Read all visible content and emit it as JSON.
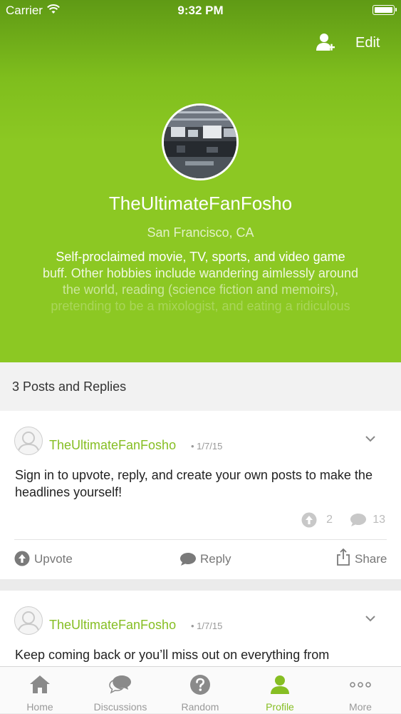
{
  "status_bar": {
    "carrier": "Carrier",
    "time": "9:32 PM"
  },
  "header": {
    "edit_label": "Edit"
  },
  "profile": {
    "username": "TheUltimateFanFosho",
    "location": "San Francisco, CA",
    "bio_lines": [
      "Self-proclaimed movie, TV, sports, and video game",
      "buff. Other hobbies include wandering aimlessly around",
      "the world, reading (science fiction and memoirs),",
      "pretending to be a mixologist, and eating a ridiculous"
    ]
  },
  "posts_header": {
    "label": "3 Posts and Replies"
  },
  "posts": [
    {
      "author": "TheUltimateFanFosho",
      "date": "• 1/7/15",
      "body": "Sign in to upvote, reply, and create your own posts to make the headlines yourself!",
      "upvotes": "2",
      "comments": "13",
      "actions": {
        "upvote": "Upvote",
        "reply": "Reply",
        "share": "Share"
      }
    },
    {
      "author": "TheUltimateFanFosho",
      "date": "• 1/7/15",
      "body": "Keep coming back or you’ll miss out on everything from"
    }
  ],
  "tabbar": {
    "items": [
      {
        "label": "Home",
        "icon": "home-icon"
      },
      {
        "label": "Discussions",
        "icon": "chat-bubbles-icon"
      },
      {
        "label": "Random",
        "icon": "question-icon"
      },
      {
        "label": "Profile",
        "icon": "person-icon",
        "active": true
      },
      {
        "label": "More",
        "icon": "more-dots-icon"
      }
    ]
  },
  "colors": {
    "brand_green": "#86be23",
    "header_green": "#8cc823"
  }
}
